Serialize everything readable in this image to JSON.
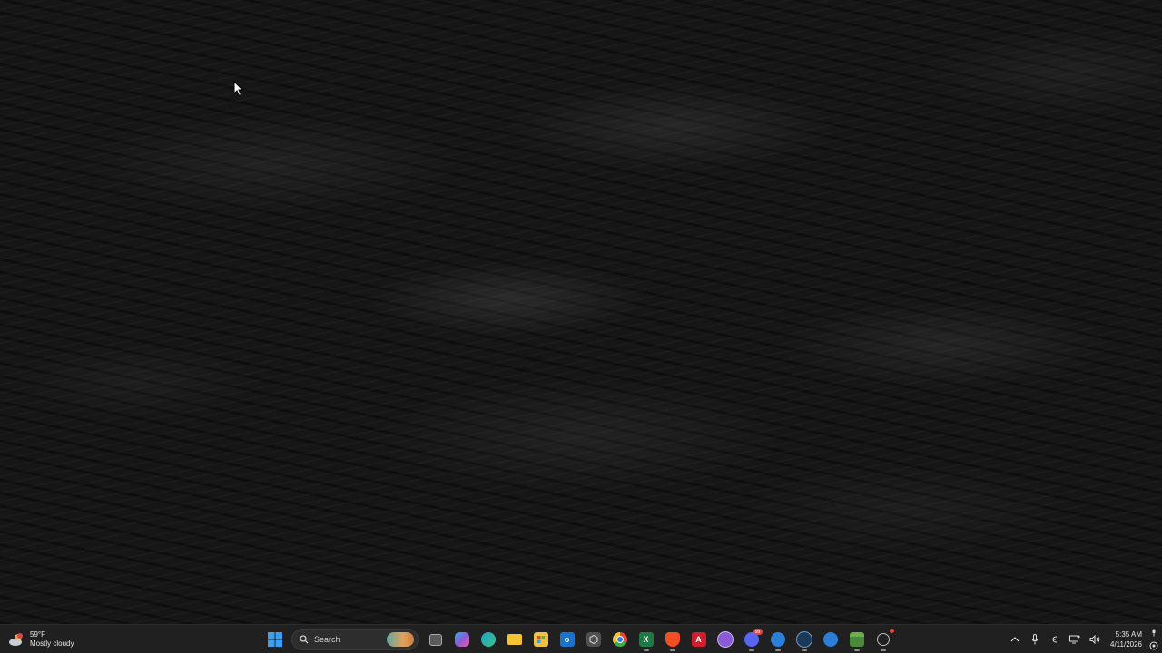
{
  "desktop": {
    "wallpaper": "dark-ocean-waves"
  },
  "weather": {
    "temp": "59°F",
    "condition": "Mostly cloudy",
    "icon": "cloudy-weather-icon"
  },
  "taskbar": {
    "search_label": "Search",
    "apps": [
      {
        "name": "start-button",
        "icon": "windows-logo-icon",
        "color": "#3aa0f0"
      },
      {
        "name": "task-view-button",
        "icon": "task-view-icon",
        "color": "#9a9a9a"
      },
      {
        "name": "copilot-button",
        "icon": "copilot-icon",
        "color": "#7a6cf0"
      },
      {
        "name": "edge-button",
        "icon": "edge-icon",
        "color": "#1fa3c8"
      },
      {
        "name": "file-explorer-button",
        "icon": "folder-icon",
        "color": "#f4c430"
      },
      {
        "name": "store-button",
        "icon": "store-icon",
        "color": "#f0c040"
      },
      {
        "name": "outlook-button",
        "icon": "outlook-icon",
        "color": "#1a73c8"
      },
      {
        "name": "settings-app-button",
        "icon": "hexagon-icon",
        "color": "#707070"
      },
      {
        "name": "chrome-button",
        "icon": "chrome-icon",
        "color": "#e04a3a"
      },
      {
        "name": "excel-button",
        "icon": "excel-icon",
        "color": "#1e7a45"
      },
      {
        "name": "brave-button",
        "icon": "brave-icon",
        "color": "#f04e23"
      },
      {
        "name": "acrobat-button",
        "icon": "acrobat-icon",
        "color": "#d01e2f"
      },
      {
        "name": "app-button-purple",
        "icon": "purple-app-icon",
        "color": "#8a5ad8"
      },
      {
        "name": "discord-button",
        "icon": "discord-icon",
        "color": "#5865f2",
        "badge": "99"
      },
      {
        "name": "app-button-blue",
        "icon": "blue-app-icon",
        "color": "#2b7fd9"
      },
      {
        "name": "steam-button",
        "icon": "steam-icon",
        "color": "#1b3a5a"
      },
      {
        "name": "app-button-blue-2",
        "icon": "blue-app-icon",
        "color": "#2b7fd9"
      },
      {
        "name": "minecraft-button",
        "icon": "minecraft-icon",
        "color": "#4a8a3a"
      },
      {
        "name": "app-button-circle",
        "icon": "circle-app-icon",
        "color": "#9a9a9a"
      }
    ]
  },
  "tray": {
    "chevron": "^",
    "clock_time": "5:35 AM",
    "clock_date": "4/11/2026"
  }
}
